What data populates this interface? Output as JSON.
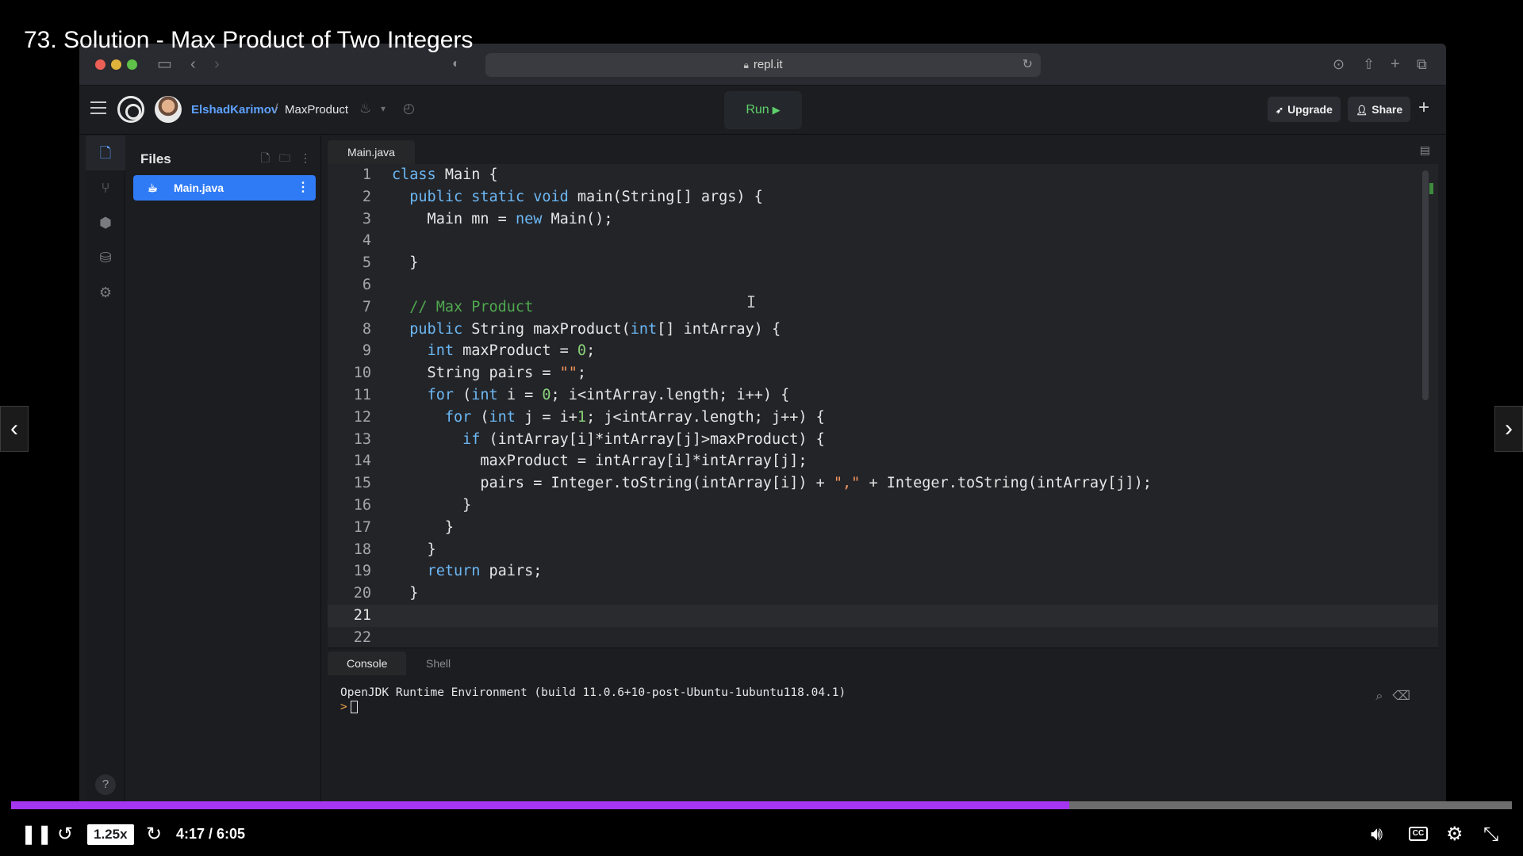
{
  "video": {
    "title": "73. Solution - Max Product of Two Integers",
    "speed": "1.25x",
    "time": "4:17 / 6:05",
    "progress_fraction": 0.705,
    "accent_color": "#a435f0"
  },
  "browser": {
    "url": "repl.it"
  },
  "replit": {
    "owner": "ElshadKarimov",
    "separator": "/",
    "repl_name": "MaxProduct",
    "run_label": "Run",
    "upgrade_label": "Upgrade",
    "share_label": "Share",
    "files_title": "Files",
    "active_file": "Main.java",
    "tab_label": "Main.java",
    "console_tab": "Console",
    "shell_tab": "Shell",
    "console_output": "OpenJDK Runtime Environment (build 11.0.6+10-post-Ubuntu-1ubuntu118.04.1)",
    "console_prompt": ">",
    "help": "?"
  },
  "code": {
    "current_line": 21,
    "lines": [
      {
        "n": "1",
        "text": "class Main {"
      },
      {
        "n": "2",
        "text": "  public static void main(String[] args) {"
      },
      {
        "n": "3",
        "text": "    Main mn = new Main();"
      },
      {
        "n": "4",
        "text": ""
      },
      {
        "n": "5",
        "text": "  }"
      },
      {
        "n": "6",
        "text": ""
      },
      {
        "n": "7",
        "text": "  // Max Product"
      },
      {
        "n": "8",
        "text": "  public String maxProduct(int[] intArray) {"
      },
      {
        "n": "9",
        "text": "    int maxProduct = 0;"
      },
      {
        "n": "10",
        "text": "    String pairs = \"\";"
      },
      {
        "n": "11",
        "text": "    for (int i = 0; i<intArray.length; i++) {"
      },
      {
        "n": "12",
        "text": "      for (int j = i+1; j<intArray.length; j++) {"
      },
      {
        "n": "13",
        "text": "        if (intArray[i]*intArray[j]>maxProduct) {"
      },
      {
        "n": "14",
        "text": "          maxProduct = intArray[i]*intArray[j];"
      },
      {
        "n": "15",
        "text": "          pairs = Integer.toString(intArray[i]) + \",\" + Integer.toString(intArray[j]);"
      },
      {
        "n": "16",
        "text": "        }"
      },
      {
        "n": "17",
        "text": "      }"
      },
      {
        "n": "18",
        "text": "    }"
      },
      {
        "n": "19",
        "text": "    return pairs;"
      },
      {
        "n": "20",
        "text": "  }"
      },
      {
        "n": "21",
        "text": ""
      },
      {
        "n": "22",
        "text": ""
      }
    ]
  },
  "icons": {
    "rail": [
      "files-icon",
      "version-control-icon",
      "packages-icon",
      "database-icon",
      "settings-icon"
    ]
  }
}
